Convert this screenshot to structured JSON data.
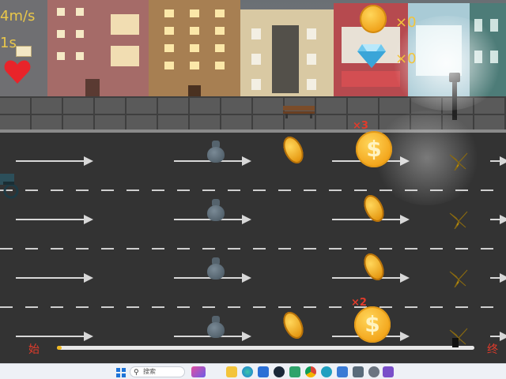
{
  "hud": {
    "speed": "4m/s",
    "distance": "1s",
    "coin_count": "×0",
    "gem_count": "×0"
  },
  "lanes": {
    "count": 4,
    "multiplier_labels": [
      "×3",
      "×2"
    ]
  },
  "progress": {
    "start_label": "始",
    "end_label": "终",
    "fraction": 0.01
  },
  "taskbar": {
    "search_placeholder": "搜索",
    "icons": [
      "windows-start-icon",
      "search-icon",
      "widgets-icon",
      "file-explorer-icon",
      "edge-icon",
      "store-icon",
      "steam-icon",
      "app-icon",
      "chrome-icon",
      "app-icon-2",
      "phone-link-icon",
      "calculator-icon",
      "settings-icon",
      "visual-studio-icon"
    ]
  },
  "colors": {
    "hud_text": "#e9c74a",
    "coin": "#f3a51b",
    "multiplier": "#e23b2b",
    "progress_fill": "#f0b820"
  }
}
